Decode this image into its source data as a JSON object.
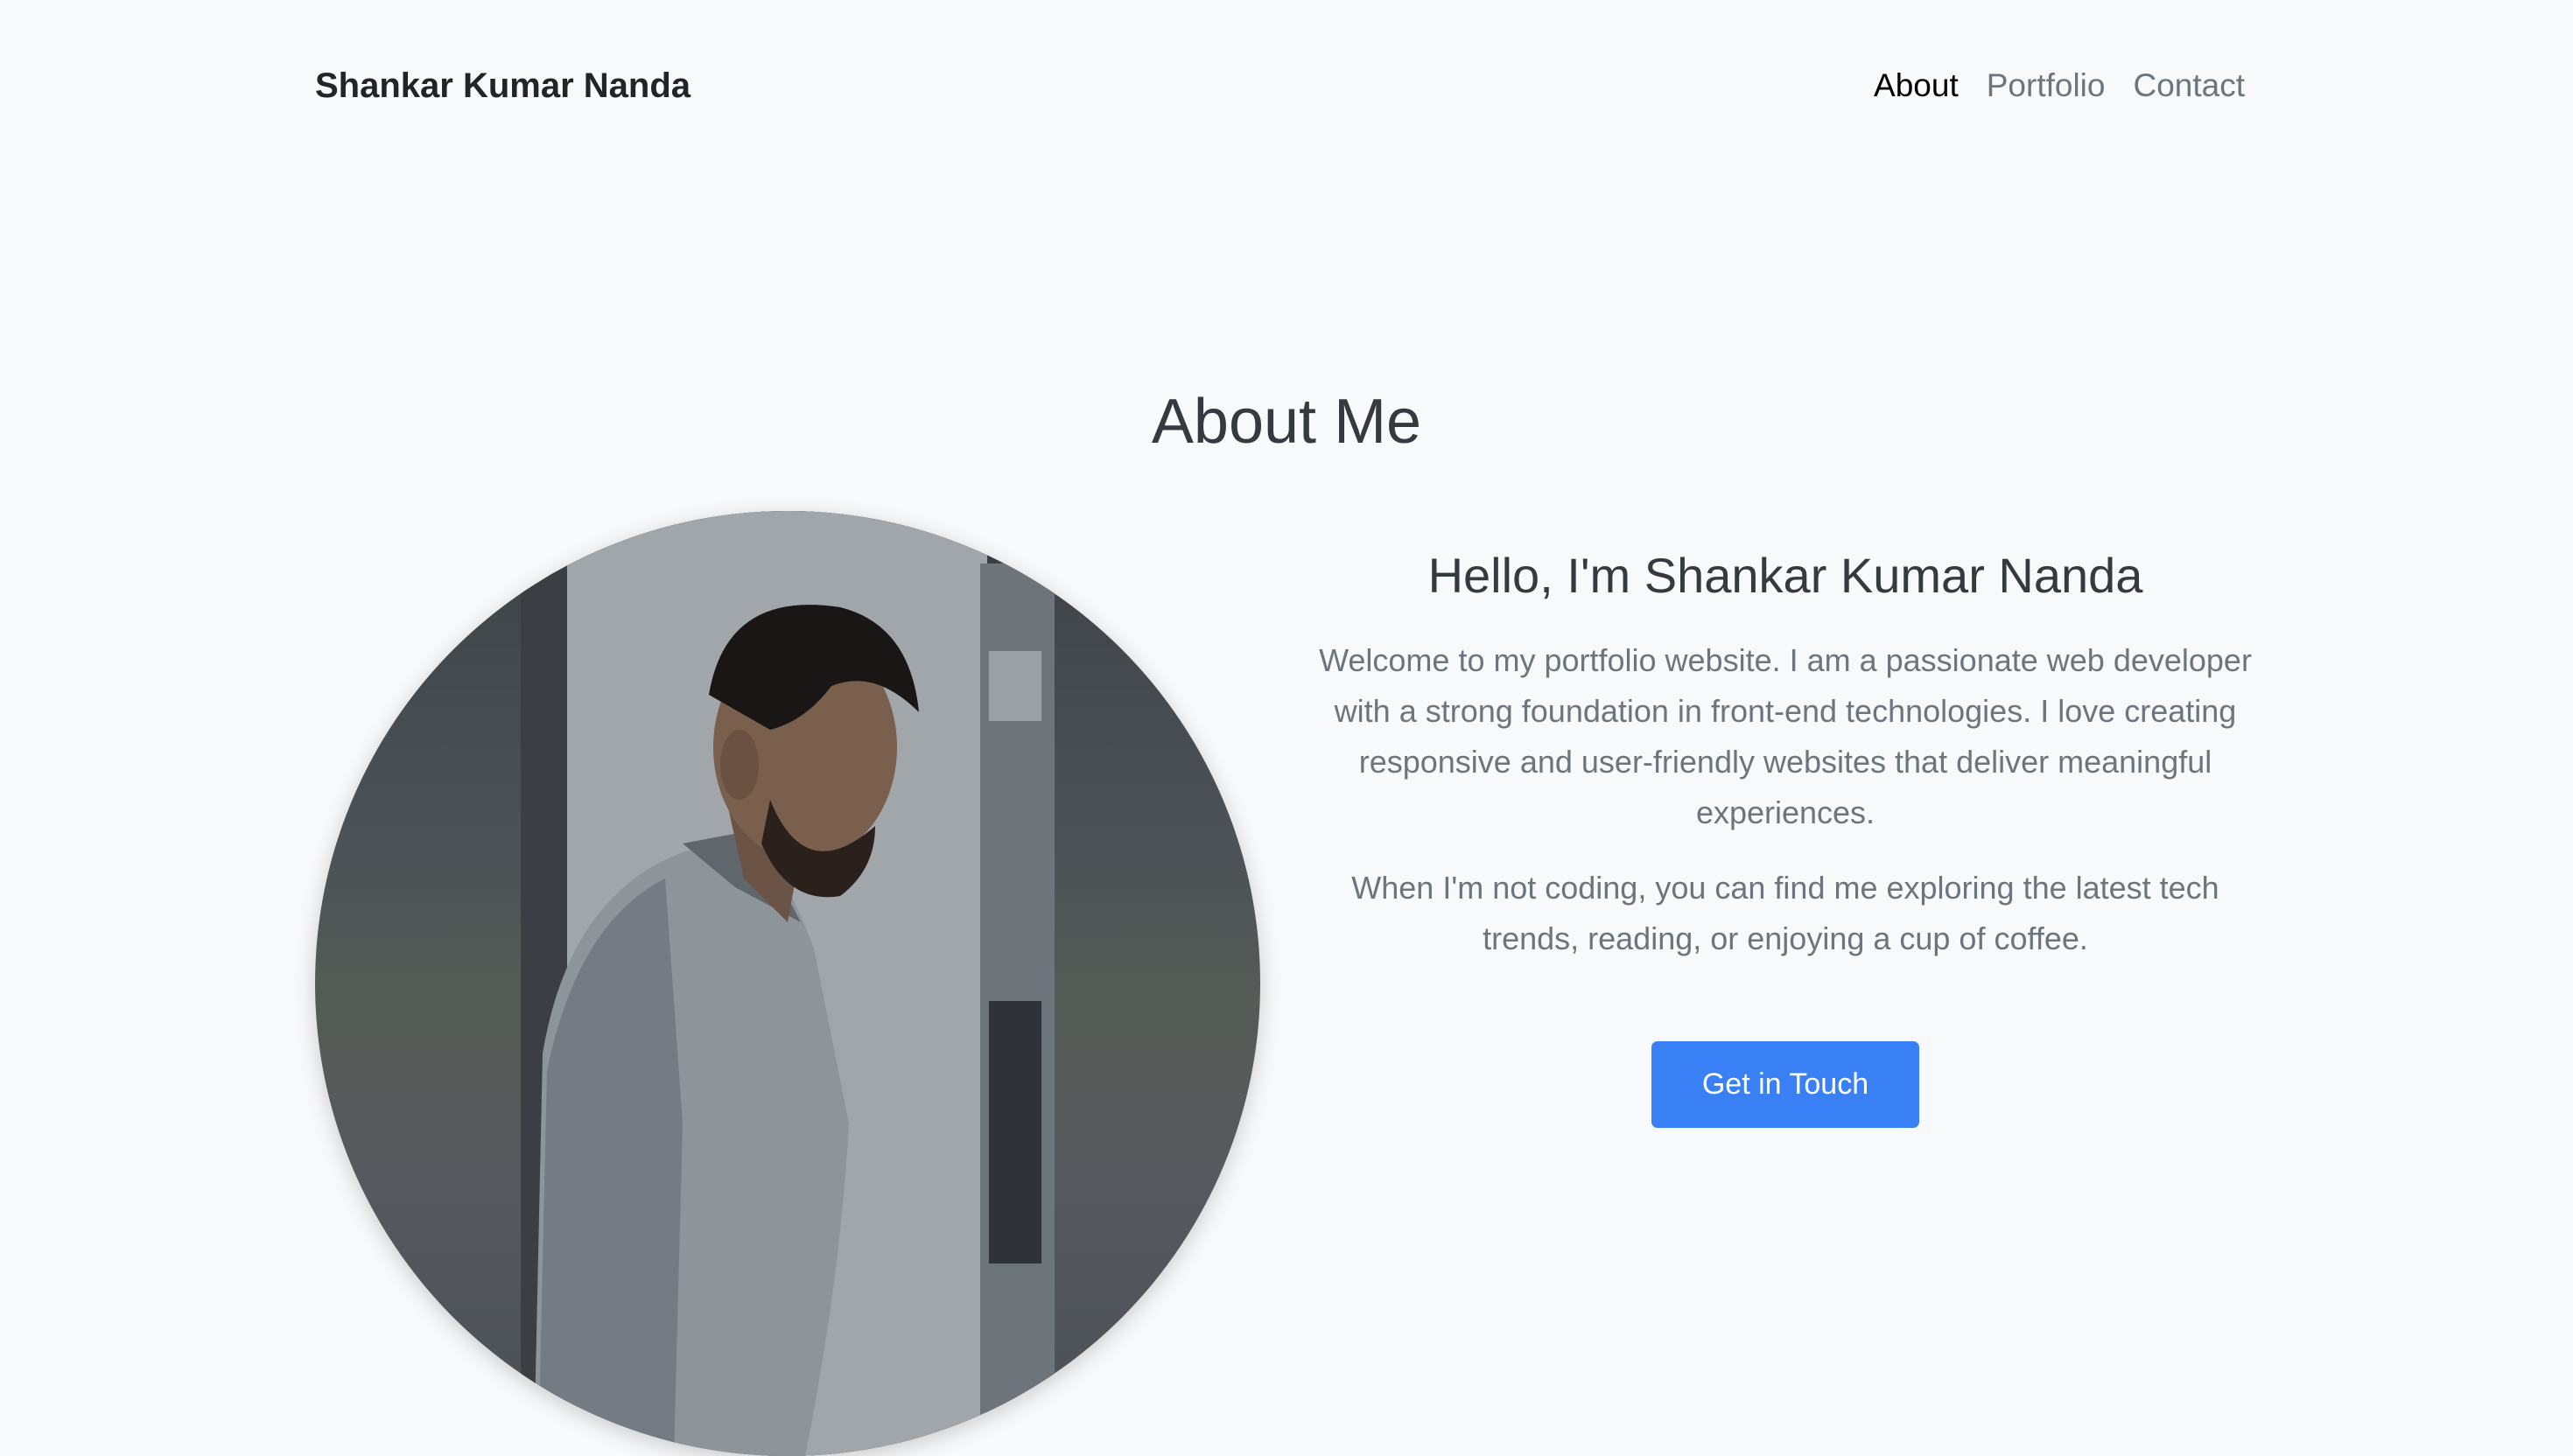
{
  "navbar": {
    "brand": "Shankar Kumar Nanda",
    "links": [
      {
        "label": "About",
        "active": true
      },
      {
        "label": "Portfolio",
        "active": false
      },
      {
        "label": "Contact",
        "active": false
      }
    ]
  },
  "about": {
    "title": "About Me",
    "heading": "Hello, I'm Shankar Kumar Nanda",
    "paragraphs": [
      "Welcome to my portfolio website. I am a passionate web developer with a strong foundation in front-end technologies. I love creating responsive and user-friendly websites that deliver meaningful experiences.",
      "When I'm not coding, you can find me exploring the latest tech trends, reading, or enjoying a cup of coffee."
    ],
    "cta_label": "Get in Touch"
  },
  "colors": {
    "background": "#f8f9fa",
    "primary": "#3a80f5",
    "text_dark": "#343a40",
    "text_muted": "#6c757d"
  }
}
